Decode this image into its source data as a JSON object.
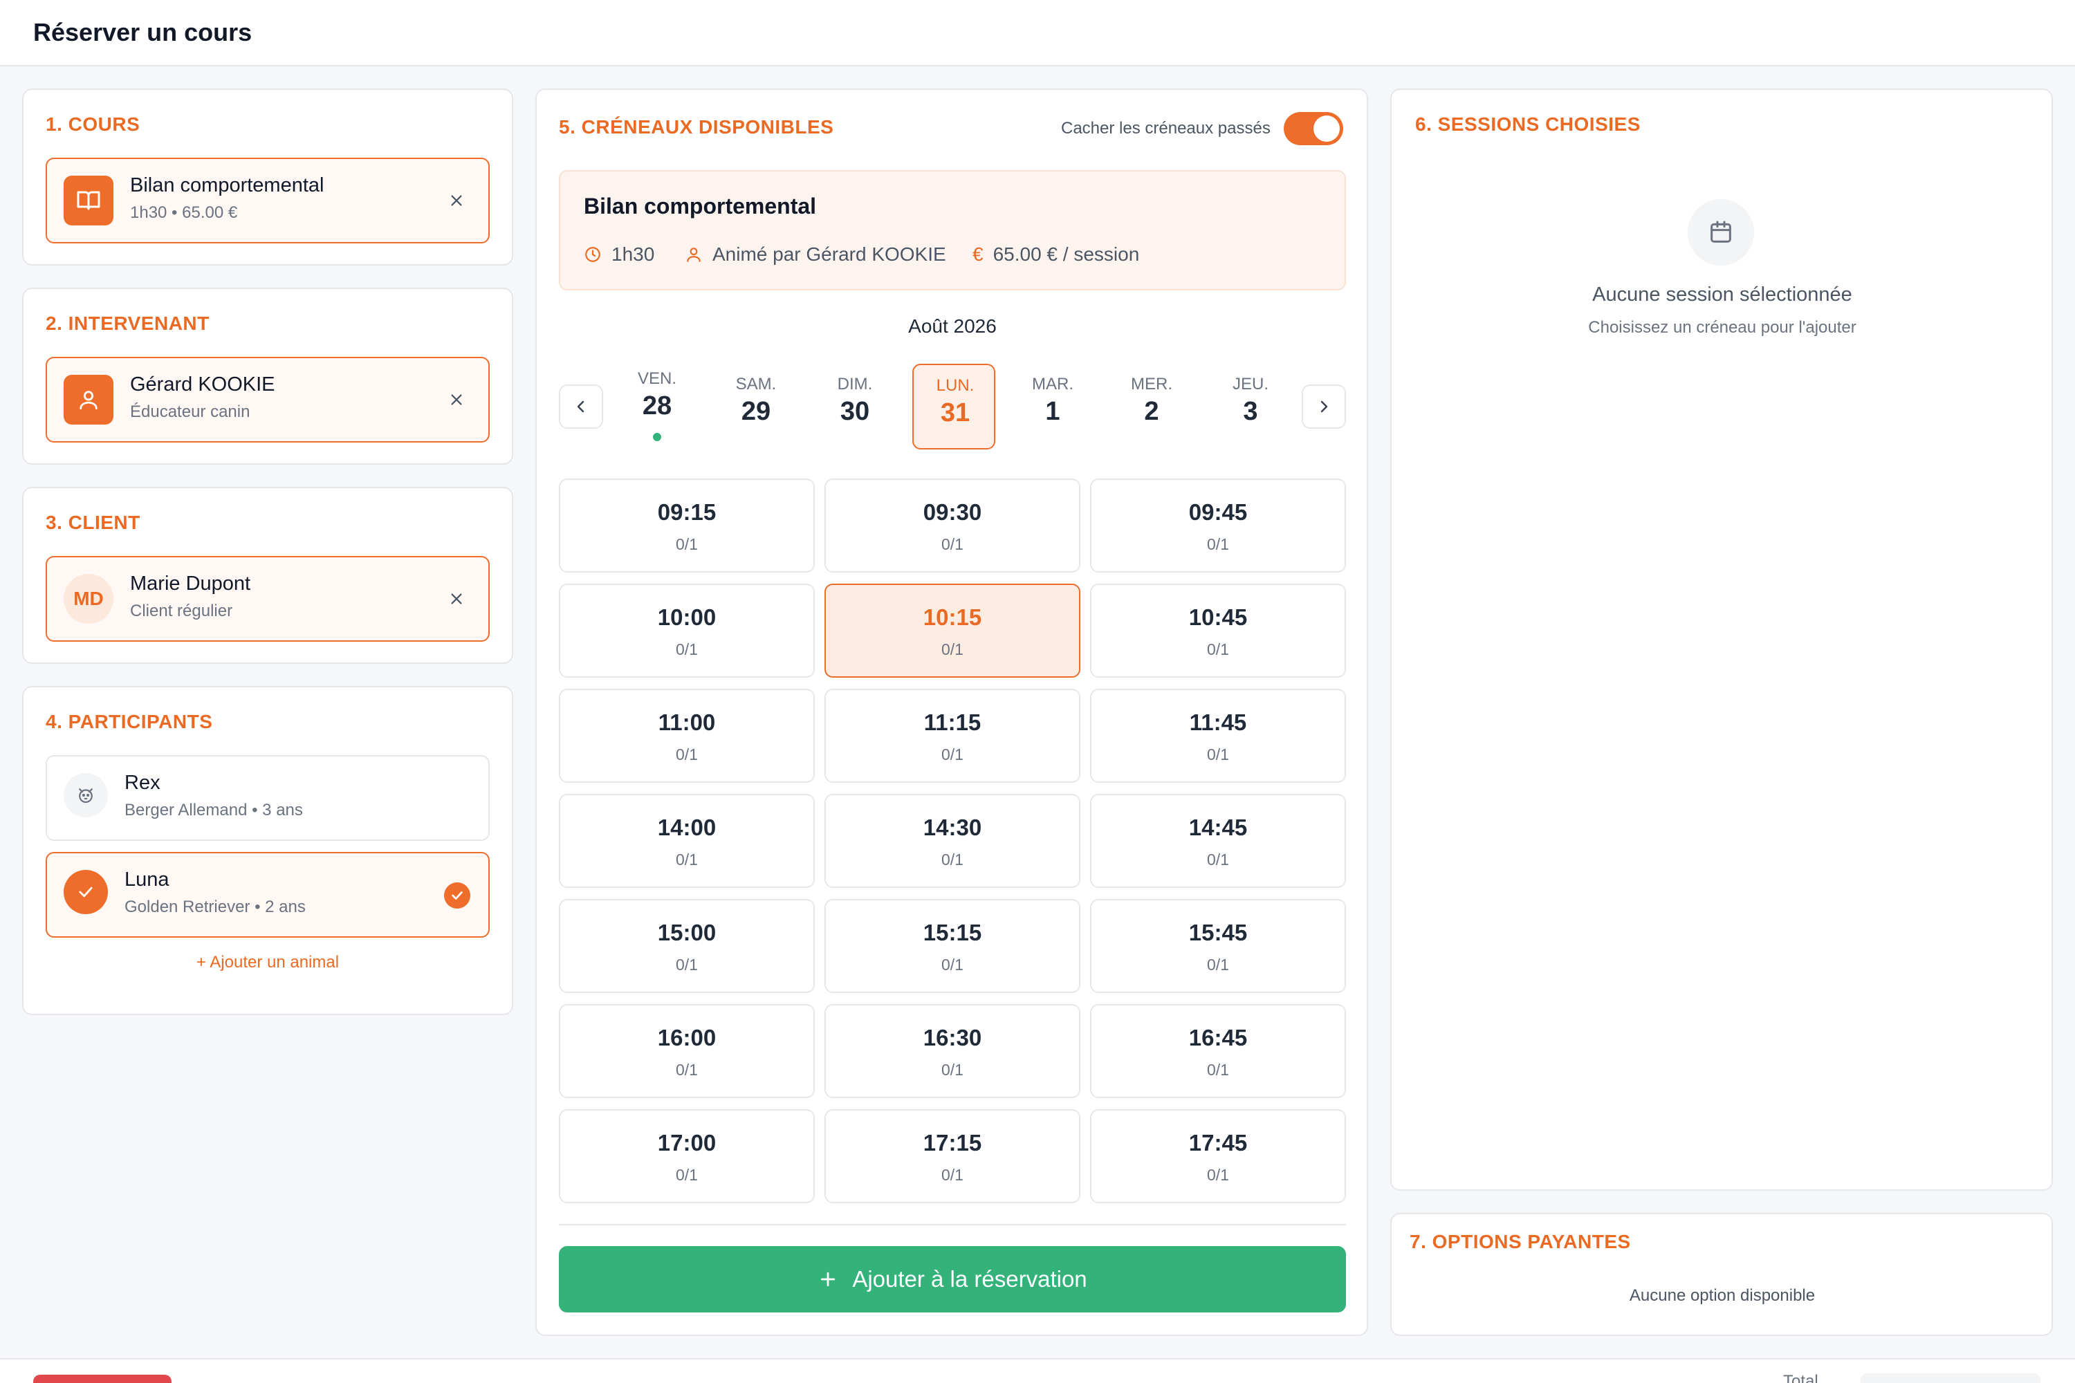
{
  "header": {
    "title": "Réserver un cours"
  },
  "course": {
    "title": "1. COURS",
    "name": "Bilan comportemental",
    "sub": "1h30 • 65.00 €",
    "icon": "book-icon"
  },
  "instructor": {
    "title": "2. INTERVENANT",
    "name": "Gérard KOOKIE",
    "sub": "Éducateur canin",
    "icon": "user-icon"
  },
  "client": {
    "title": "3. CLIENT",
    "initials": "MD",
    "name": "Marie Dupont",
    "sub": "Client régulier"
  },
  "participants": {
    "title": "4. PARTICIPANTS",
    "items": [
      {
        "name": "Rex",
        "sub": "Berger Allemand • 3 ans",
        "selected": false
      },
      {
        "name": "Luna",
        "sub": "Golden Retriever • 2 ans",
        "selected": true
      }
    ],
    "add_label": "+ Ajouter un animal"
  },
  "slots_section": {
    "title": "5. CRÉNEAUX DISPONIBLES",
    "toggle_label": "Cacher les créneaux passés",
    "toggle_on": true,
    "info": {
      "title": "Bilan comportemental",
      "duration": "1h30",
      "instructor": "Animé par Gérard KOOKIE",
      "price": "65.00 € / session"
    },
    "month": "Août 2026",
    "days": [
      {
        "name": "VEN.",
        "num": "28",
        "dot": true,
        "active": false
      },
      {
        "name": "SAM.",
        "num": "29",
        "dot": false,
        "active": false
      },
      {
        "name": "DIM.",
        "num": "30",
        "dot": false,
        "active": false
      },
      {
        "name": "LUN.",
        "num": "31",
        "dot": false,
        "active": true
      },
      {
        "name": "MAR.",
        "num": "1",
        "dot": false,
        "active": false
      },
      {
        "name": "MER.",
        "num": "2",
        "dot": false,
        "active": false
      },
      {
        "name": "JEU.",
        "num": "3",
        "dot": false,
        "active": false
      }
    ],
    "slots": [
      {
        "time": "09:15",
        "cap": "0/1"
      },
      {
        "time": "09:30",
        "cap": "0/1"
      },
      {
        "time": "09:45",
        "cap": "0/1"
      },
      {
        "time": "10:00",
        "cap": "0/1"
      },
      {
        "time": "10:15",
        "cap": "0/1",
        "active": true
      },
      {
        "time": "10:45",
        "cap": "0/1"
      },
      {
        "time": "11:00",
        "cap": "0/1"
      },
      {
        "time": "11:15",
        "cap": "0/1"
      },
      {
        "time": "11:45",
        "cap": "0/1"
      },
      {
        "time": "14:00",
        "cap": "0/1"
      },
      {
        "time": "14:30",
        "cap": "0/1"
      },
      {
        "time": "14:45",
        "cap": "0/1"
      },
      {
        "time": "15:00",
        "cap": "0/1"
      },
      {
        "time": "15:15",
        "cap": "0/1"
      },
      {
        "time": "15:45",
        "cap": "0/1"
      },
      {
        "time": "16:00",
        "cap": "0/1"
      },
      {
        "time": "16:30",
        "cap": "0/1"
      },
      {
        "time": "16:45",
        "cap": "0/1"
      },
      {
        "time": "17:00",
        "cap": "0/1"
      },
      {
        "time": "17:15",
        "cap": "0/1"
      },
      {
        "time": "17:45",
        "cap": "0/1"
      }
    ],
    "add_button": "Ajouter à la réservation"
  },
  "sessions": {
    "title": "6. SESSIONS CHOISIES",
    "empty_title": "Aucune session sélectionnée",
    "empty_sub": "Choisissez un créneau pour l'ajouter"
  },
  "options": {
    "title": "7. OPTIONS PAYANTES",
    "empty": "Aucune option disponible"
  },
  "footer": {
    "total_label": "Total"
  },
  "colors": {
    "accent": "#ee6d2a",
    "success": "#33b27a",
    "danger": "#e0484b"
  }
}
